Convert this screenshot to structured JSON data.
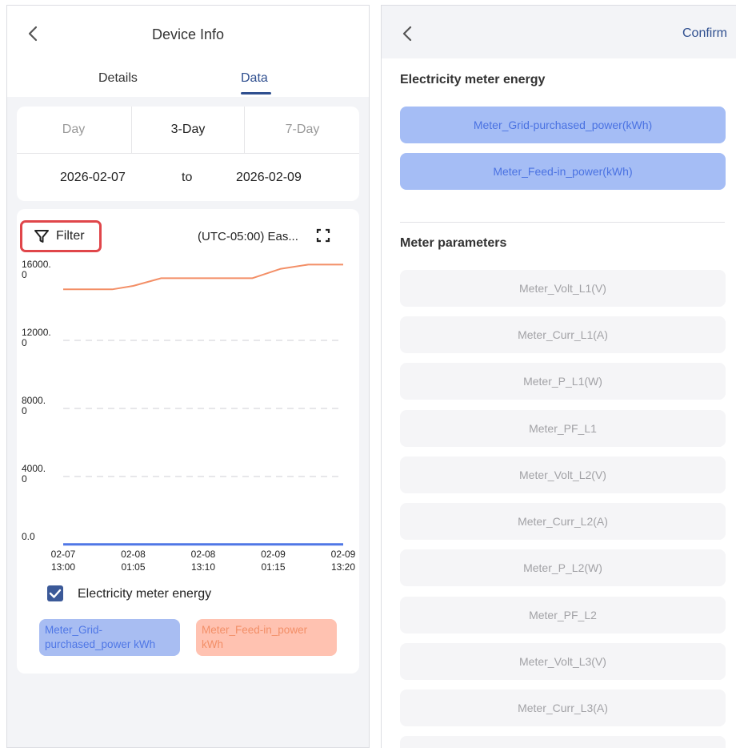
{
  "left": {
    "title": "Device Info",
    "tabs": [
      "Details",
      "Data"
    ],
    "active_tab": "Data",
    "ranges": [
      "Day",
      "3-Day",
      "7-Day"
    ],
    "active_range": "3-Day",
    "date_from": "2026-02-07",
    "date_sep": "to",
    "date_to": "2026-02-09",
    "filter_label": "Filter",
    "timezone": "(UTC-05:00) Eas...",
    "legend_group": "Electricity meter energy",
    "legend_checked": true,
    "legend_items": [
      "Meter_Grid-purchased_power kWh",
      "Meter_Feed-in_power kWh"
    ]
  },
  "right": {
    "confirm_label": "Confirm",
    "section_energy": "Electricity meter energy",
    "energy_options": [
      "Meter_Grid-purchased_power(kWh)",
      "Meter_Feed-in_power(kWh)"
    ],
    "section_params": "Meter parameters",
    "param_options": [
      "Meter_Volt_L1(V)",
      "Meter_Curr_L1(A)",
      "Meter_P_L1(W)",
      "Meter_PF_L1",
      "Meter_Volt_L2(V)",
      "Meter_Curr_L2(A)",
      "Meter_P_L2(W)",
      "Meter_PF_L2",
      "Meter_Volt_L3(V)",
      "Meter_Curr_L3(A)"
    ]
  },
  "colors": {
    "accent": "#2f4f8f",
    "grid_purchased": "#4f77e6",
    "feed_in": "#f38f67",
    "filter_highlight": "#e0464a"
  },
  "icons": [
    "back-arrow-icon",
    "filter-icon",
    "expand-icon",
    "checkbox-checked-icon"
  ],
  "chart_data": {
    "type": "line",
    "x_ticks": [
      "02-07\n13:00",
      "02-08\n01:05",
      "02-08\n13:10",
      "02-09\n01:15",
      "02-09\n13:20"
    ],
    "y_ticks": [
      "16000.\n0",
      "12000.\n0",
      "8000.\n0",
      "4000.\n0",
      "0.0"
    ],
    "ylim": [
      0,
      16000
    ],
    "grid": "dashed horizontal",
    "series": [
      {
        "name": "Meter_Grid-purchased_power kWh",
        "color": "#4f77e6",
        "x": [
          0,
          4
        ],
        "y": [
          10,
          10
        ]
      },
      {
        "name": "Meter_Feed-in_power kWh",
        "color": "#f38f67",
        "x": [
          0,
          0.7,
          1.0,
          1.4,
          2.7,
          3.1,
          3.5,
          4
        ],
        "y": [
          15000,
          15000,
          15200,
          15650,
          15650,
          16200,
          16450,
          16450
        ]
      }
    ]
  }
}
